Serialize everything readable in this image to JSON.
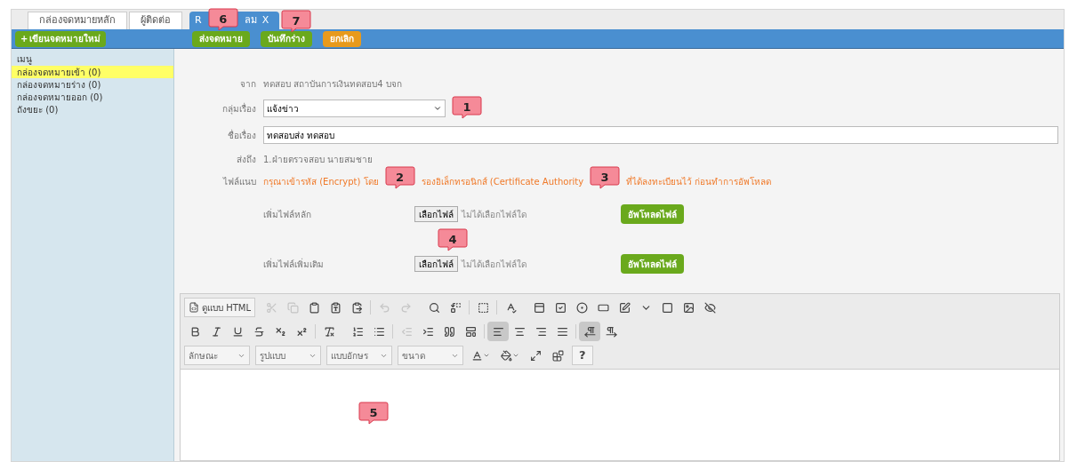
{
  "tabs": [
    {
      "kind": "plain",
      "label": "กล่องจดหมายหลัก",
      "selected": false
    },
    {
      "kind": "plain",
      "label": "ผู้ติดต่อ",
      "selected": false
    },
    {
      "kind": "closable",
      "label_start": "R",
      "label_end": "ลม",
      "close": "X",
      "selected": true
    }
  ],
  "toolbar": {
    "new_button": {
      "icon": "+",
      "label": "เขียนจดหมายใหม่"
    },
    "buttons": [
      {
        "label": "ส่งจดหมาย",
        "color": "#6aa91c"
      },
      {
        "label": "บันทึกร่าง",
        "color": "#6aa91c"
      },
      {
        "label": "ยกเลิก",
        "color": "#e89a1c"
      }
    ]
  },
  "sidebar": {
    "title": "เมนู",
    "items": [
      {
        "label": "กล่องจดหมายเข้า (0)",
        "selected": true
      },
      {
        "label": "กล่องจดหมายร่าง (0)",
        "selected": false
      },
      {
        "label": "กล่องจดหมายออก (0)",
        "selected": false
      },
      {
        "label": "ถังขยะ (0)",
        "selected": false
      }
    ]
  },
  "form": {
    "from": {
      "label": "จาก",
      "value": "ทดสอบ สถาบันการเงินทดสอบ4 บจก"
    },
    "group": {
      "label": "กลุ่มเรื่อง",
      "value": "แจ้งข่าว"
    },
    "subject": {
      "label": "ชื่อเรื่อง",
      "value": "ทดสอบส่ง ทดสอบ"
    },
    "to": {
      "label": "ส่งถึง",
      "value": "1.ฝ่ายตรวจสอบ นายสมชาย"
    },
    "attachment": {
      "label": "ไฟล์แนบ",
      "warning_parts": [
        "กรุณาเข้ารหัส (Encrypt) โดย",
        "รองอิเล็กทรอนิกส์ (Certificate Authority",
        "ที่ได้ลงทะเบียนไว้ ก่อนทำการอัพโหลด"
      ]
    },
    "files": [
      {
        "label": "เพิ่มไฟล์หลัก",
        "choose": "เลือกไฟล์",
        "status": "ไม่ได้เลือกไฟล์ใด",
        "upload": "อัพโหลดไฟล์"
      },
      {
        "label": "เพิ่มไฟล์เพิ่มเติม",
        "choose": "เลือกไฟล์",
        "status": "ไม่ได้เลือกไฟล์ใด",
        "upload": "อัพโหลดไฟล์"
      }
    ]
  },
  "editor": {
    "source_button": "ดูแบบ HTML",
    "row1": [
      {
        "kind": "cut",
        "disabled": true
      },
      {
        "kind": "copy",
        "disabled": true
      },
      {
        "kind": "paste",
        "disabled": false
      },
      {
        "kind": "paste-text",
        "disabled": false
      },
      {
        "kind": "paste-word",
        "disabled": false
      },
      {
        "kind": "sep"
      },
      {
        "kind": "undo",
        "disabled": true
      },
      {
        "kind": "redo",
        "disabled": true
      },
      {
        "kind": "gap"
      },
      {
        "kind": "find",
        "disabled": false
      },
      {
        "kind": "replace",
        "disabled": false
      },
      {
        "kind": "sep"
      },
      {
        "kind": "select-all",
        "disabled": false
      },
      {
        "kind": "sep"
      },
      {
        "kind": "spellcheck",
        "disabled": false
      },
      {
        "kind": "gap"
      },
      {
        "kind": "form",
        "disabled": false
      },
      {
        "kind": "checkbox",
        "disabled": false
      },
      {
        "kind": "radio",
        "disabled": false
      },
      {
        "kind": "textfield",
        "disabled": false
      },
      {
        "kind": "textarea",
        "disabled": false
      },
      {
        "kind": "select",
        "disabled": false
      },
      {
        "kind": "button",
        "disabled": false
      },
      {
        "kind": "imagebutton",
        "disabled": false
      },
      {
        "kind": "hidden",
        "disabled": false
      }
    ],
    "row2": [
      {
        "kind": "bold",
        "disabled": false
      },
      {
        "kind": "italic",
        "disabled": false
      },
      {
        "kind": "underline",
        "disabled": false
      },
      {
        "kind": "strike",
        "disabled": false
      },
      {
        "kind": "subscript",
        "disabled": false
      },
      {
        "kind": "superscript",
        "disabled": false
      },
      {
        "kind": "sep"
      },
      {
        "kind": "removeformat",
        "disabled": false
      },
      {
        "kind": "gap"
      },
      {
        "kind": "numbered",
        "disabled": false
      },
      {
        "kind": "bulleted",
        "disabled": false
      },
      {
        "kind": "sep"
      },
      {
        "kind": "outdent",
        "disabled": true
      },
      {
        "kind": "indent",
        "disabled": false
      },
      {
        "kind": "quote",
        "disabled": false
      },
      {
        "kind": "div",
        "disabled": false
      },
      {
        "kind": "sep"
      },
      {
        "kind": "align-left",
        "disabled": false,
        "selected": true
      },
      {
        "kind": "align-center",
        "disabled": false,
        "selected": false
      },
      {
        "kind": "align-right",
        "disabled": false,
        "selected": false
      },
      {
        "kind": "align-justify",
        "disabled": false,
        "selected": false
      },
      {
        "kind": "sep"
      },
      {
        "kind": "ltr",
        "disabled": false,
        "selected": true
      },
      {
        "kind": "rtl",
        "disabled": false,
        "selected": false
      }
    ],
    "dropdowns": [
      "ลักษณะ",
      "รูปแบบ",
      "แบบอักษร",
      "ขนาด"
    ],
    "help": "?"
  },
  "callouts": [
    "6",
    "7",
    "1",
    "2",
    "3",
    "4",
    "5"
  ]
}
